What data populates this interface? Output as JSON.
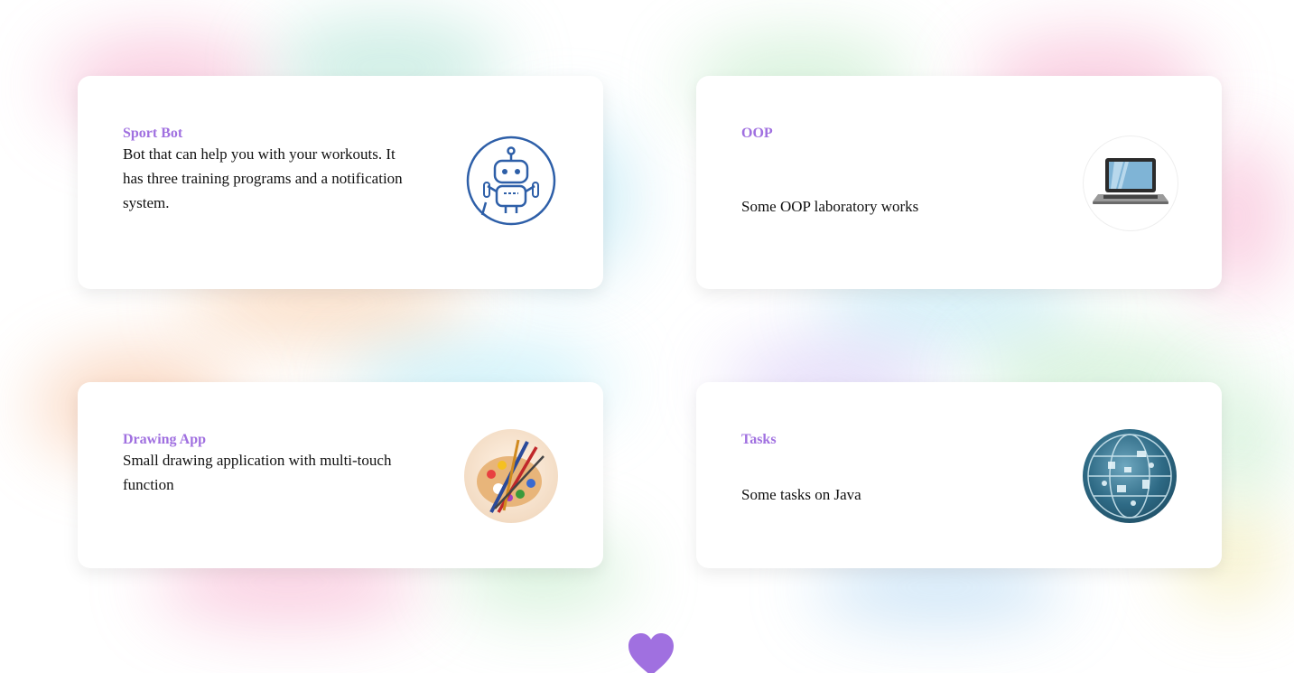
{
  "cards": [
    {
      "title": "Sport Bot",
      "description": "Bot that can help you with your workouts. It has three training programs and a notification system.",
      "icon": "robot-chat-icon"
    },
    {
      "title": "OOP",
      "description": "Some OOP laboratory works",
      "icon": "laptop-icon"
    },
    {
      "title": "Drawing App",
      "description": "Small drawing application with multi-touch function",
      "icon": "paint-palette-icon"
    },
    {
      "title": "Tasks",
      "description": "Some tasks on Java",
      "icon": "globe-network-icon"
    }
  ],
  "footer": {
    "icon": "heart-icon"
  },
  "colors": {
    "title": "#a070e0",
    "heart": "#a070e0",
    "robot_stroke": "#2e5fa8"
  }
}
